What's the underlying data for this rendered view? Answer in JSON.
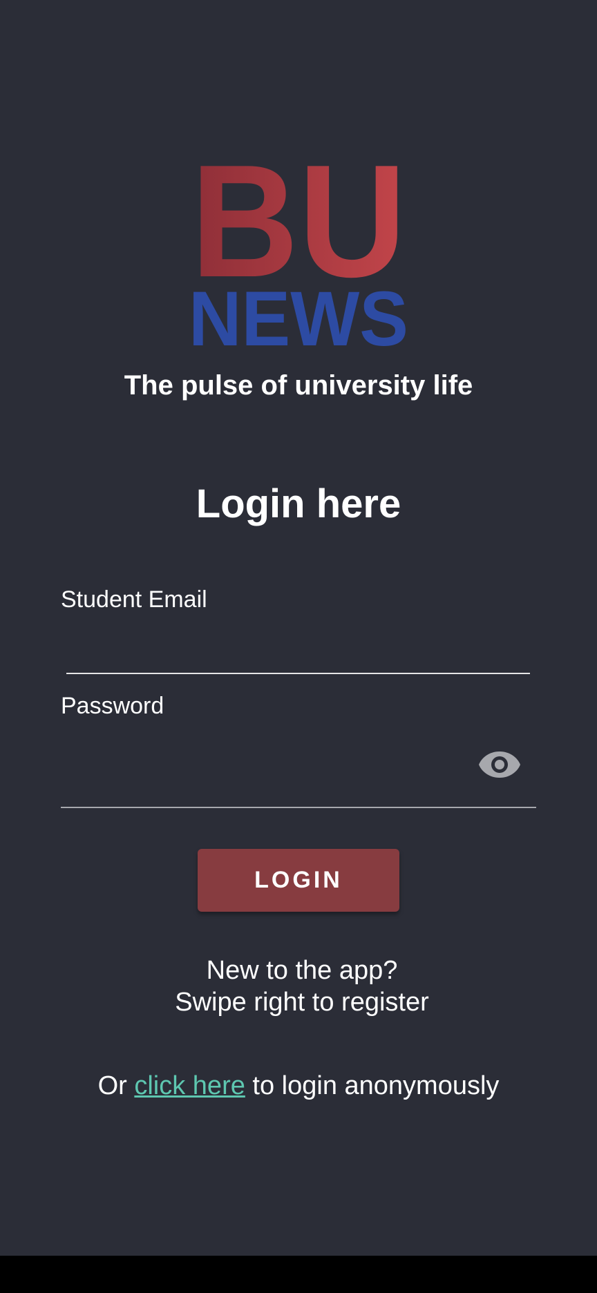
{
  "app": {
    "logo": {
      "top_text": "BU",
      "bottom_text": "NEWS",
      "top_colors": [
        "#8f2f38",
        "#c2454a"
      ],
      "bottom_color": "#2d4ba3"
    },
    "tagline": "The pulse of university life"
  },
  "login": {
    "heading": "Login here",
    "email_label": "Student Email",
    "email_value": "",
    "password_label": "Password",
    "password_value": "",
    "password_toggle_icon": "eye-icon",
    "button_label": "LOGIN",
    "register_line1": "New to the app?",
    "register_line2": "Swipe right to register",
    "anon_prefix": "Or",
    "anon_link": "click here",
    "anon_suffix": "to login anonymously"
  },
  "colors": {
    "background": "#2b2d37",
    "button": "#873c40",
    "link": "#5ec7b0",
    "text": "#ffffff"
  }
}
